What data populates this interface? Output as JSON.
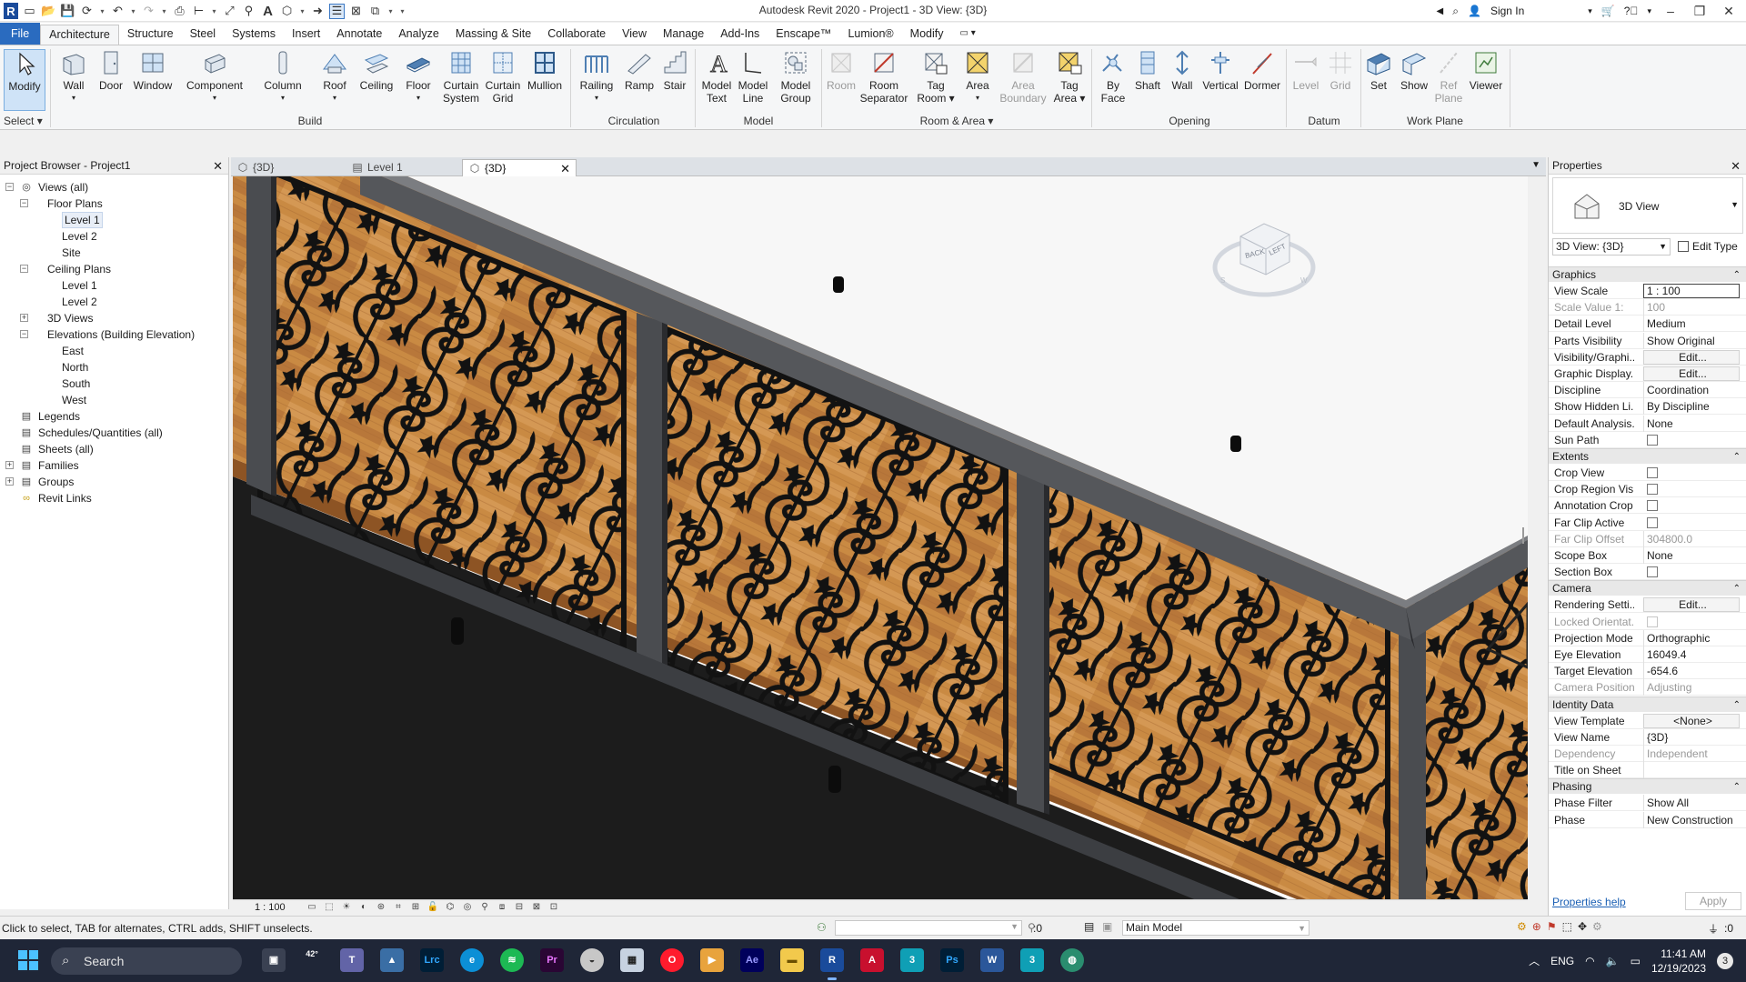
{
  "window": {
    "title": "Autodesk Revit 2020 - Project1 - 3D View: {3D}",
    "sign_in": "Sign In",
    "minimize": "–",
    "restore": "❐",
    "close": "✕"
  },
  "ribbon_tabs": [
    "File",
    "Architecture",
    "Structure",
    "Steel",
    "Systems",
    "Insert",
    "Annotate",
    "Analyze",
    "Massing & Site",
    "Collaborate",
    "View",
    "Manage",
    "Add-Ins",
    "Enscape™",
    "Lumion®",
    "Modify"
  ],
  "ribbon": {
    "select": {
      "modify": "Modify",
      "label": "Select"
    },
    "build": {
      "label": "Build",
      "wall": "Wall",
      "door": "Door",
      "window": "Window",
      "component": "Component",
      "column": "Column",
      "roof": "Roof",
      "ceiling": "Ceiling",
      "floor": "Floor",
      "curtain_system_1": "Curtain",
      "curtain_system_2": "System",
      "curtain_grid_1": "Curtain",
      "curtain_grid_2": "Grid",
      "mullion": "Mullion"
    },
    "circulation": {
      "label": "Circulation",
      "railing": "Railing",
      "ramp": "Ramp",
      "stair": "Stair"
    },
    "model": {
      "label": "Model",
      "model_text_1": "Model",
      "model_text_2": "Text",
      "model_line_1": "Model",
      "model_line_2": "Line",
      "model_group_1": "Model",
      "model_group_2": "Group"
    },
    "room_area": {
      "label": "Room & Area",
      "room": "Room",
      "room_sep_1": "Room",
      "room_sep_2": "Separator",
      "tag_room_1": "Tag",
      "tag_room_2": "Room",
      "area": "Area",
      "area_boundary_1": "Area",
      "area_boundary_2": "Boundary",
      "tag_area_1": "Tag",
      "tag_area_2": "Area"
    },
    "opening": {
      "label": "Opening",
      "by_face_1": "By",
      "by_face_2": "Face",
      "shaft": "Shaft",
      "wall": "Wall",
      "vertical": "Vertical",
      "dormer": "Dormer"
    },
    "datum": {
      "label": "Datum",
      "level": "Level",
      "grid": "Grid"
    },
    "work_plane": {
      "label": "Work Plane",
      "set": "Set",
      "show": "Show",
      "ref_plane_1": "Ref",
      "ref_plane_2": "Plane",
      "viewer": "Viewer"
    }
  },
  "browser": {
    "title": "Project Browser - Project1",
    "nodes": [
      {
        "label": "Views (all)",
        "level": 0,
        "toggle": "−"
      },
      {
        "label": "Floor Plans",
        "level": 1,
        "toggle": "−"
      },
      {
        "label": "Level 1",
        "level": 2,
        "selected": true
      },
      {
        "label": "Level 2",
        "level": 2
      },
      {
        "label": "Site",
        "level": 2
      },
      {
        "label": "Ceiling Plans",
        "level": 1,
        "toggle": "−"
      },
      {
        "label": "Level 1",
        "level": 2
      },
      {
        "label": "Level 2",
        "level": 2
      },
      {
        "label": "3D Views",
        "level": 1,
        "toggle": "+"
      },
      {
        "label": "Elevations (Building Elevation)",
        "level": 1,
        "toggle": "−"
      },
      {
        "label": "East",
        "level": 2
      },
      {
        "label": "North",
        "level": 2
      },
      {
        "label": "South",
        "level": 2
      },
      {
        "label": "West",
        "level": 2
      },
      {
        "label": "Legends",
        "level": 0,
        "icon": true
      },
      {
        "label": "Schedules/Quantities (all)",
        "level": 0,
        "icon": true
      },
      {
        "label": "Sheets (all)",
        "level": 0,
        "icon": true
      },
      {
        "label": "Families",
        "level": 0,
        "toggle": "+",
        "icon": true
      },
      {
        "label": "Groups",
        "level": 0,
        "toggle": "+",
        "icon": true
      },
      {
        "label": "Revit Links",
        "level": 0,
        "icon": true
      }
    ]
  },
  "view_tabs": [
    {
      "label": "{3D}",
      "active": false
    },
    {
      "label": "Level 1",
      "active": false
    },
    {
      "label": "{3D}",
      "active": true
    }
  ],
  "viewcube": {
    "back": "BACK",
    "left": "LEFT"
  },
  "view_control": {
    "scale": "1 : 100"
  },
  "properties": {
    "title": "Properties",
    "type_name": "3D View",
    "instance": "3D View: {3D}",
    "edit_type": "Edit Type",
    "groups": [
      {
        "name": "Graphics",
        "rows": [
          {
            "k": "View Scale",
            "v": "1 : 100",
            "style": "boxed"
          },
          {
            "k": "Scale Value    1:",
            "v": "100",
            "dim": true
          },
          {
            "k": "Detail Level",
            "v": "Medium"
          },
          {
            "k": "Parts Visibility",
            "v": "Show Original"
          },
          {
            "k": "Visibility/Graphi...",
            "v": "Edit...",
            "style": "btn"
          },
          {
            "k": "Graphic Display...",
            "v": "Edit...",
            "style": "btn"
          },
          {
            "k": "Discipline",
            "v": "Coordination"
          },
          {
            "k": "Show Hidden Li...",
            "v": "By Discipline"
          },
          {
            "k": "Default Analysis...",
            "v": "None"
          },
          {
            "k": "Sun Path",
            "v": "",
            "style": "check"
          }
        ]
      },
      {
        "name": "Extents",
        "rows": [
          {
            "k": "Crop View",
            "v": "",
            "style": "check"
          },
          {
            "k": "Crop Region Vis...",
            "v": "",
            "style": "check"
          },
          {
            "k": "Annotation Crop",
            "v": "",
            "style": "check"
          },
          {
            "k": "Far Clip Active",
            "v": "",
            "style": "check"
          },
          {
            "k": "Far Clip Offset",
            "v": "304800.0",
            "dim": true
          },
          {
            "k": "Scope Box",
            "v": "None"
          },
          {
            "k": "Section Box",
            "v": "",
            "style": "check"
          }
        ]
      },
      {
        "name": "Camera",
        "rows": [
          {
            "k": "Rendering Setti...",
            "v": "Edit...",
            "style": "btn"
          },
          {
            "k": "Locked Orientat...",
            "v": "",
            "style": "check",
            "dim": true
          },
          {
            "k": "Projection Mode",
            "v": "Orthographic"
          },
          {
            "k": "Eye Elevation",
            "v": "16049.4"
          },
          {
            "k": "Target Elevation",
            "v": "-654.6"
          },
          {
            "k": "Camera Position",
            "v": "Adjusting",
            "dim": true
          }
        ]
      },
      {
        "name": "Identity Data",
        "rows": [
          {
            "k": "View Template",
            "v": "<None>",
            "style": "btn"
          },
          {
            "k": "View Name",
            "v": "{3D}"
          },
          {
            "k": "Dependency",
            "v": "Independent",
            "dim": true
          },
          {
            "k": "Title on Sheet",
            "v": ""
          }
        ]
      },
      {
        "name": "Phasing",
        "rows": [
          {
            "k": "Phase Filter",
            "v": "Show All"
          },
          {
            "k": "Phase",
            "v": "New Construction"
          }
        ]
      }
    ],
    "help": "Properties help",
    "apply": "Apply"
  },
  "status": {
    "message": "Click to select, TAB for alternates, CTRL adds, SHIFT unselects.",
    "count": ":0",
    "model": "Main Model",
    "filter": ":0"
  },
  "taskbar": {
    "search": "Search",
    "temp": "42°",
    "lang": "ENG",
    "time": "11:41 AM",
    "date": "12/19/2023",
    "badge": "3"
  },
  "colors": {
    "accent": "#2a6bbf",
    "taskbar": "#1f2637",
    "wood": "#c8873f",
    "iron": "#141414",
    "steel": "#4a4c50"
  }
}
